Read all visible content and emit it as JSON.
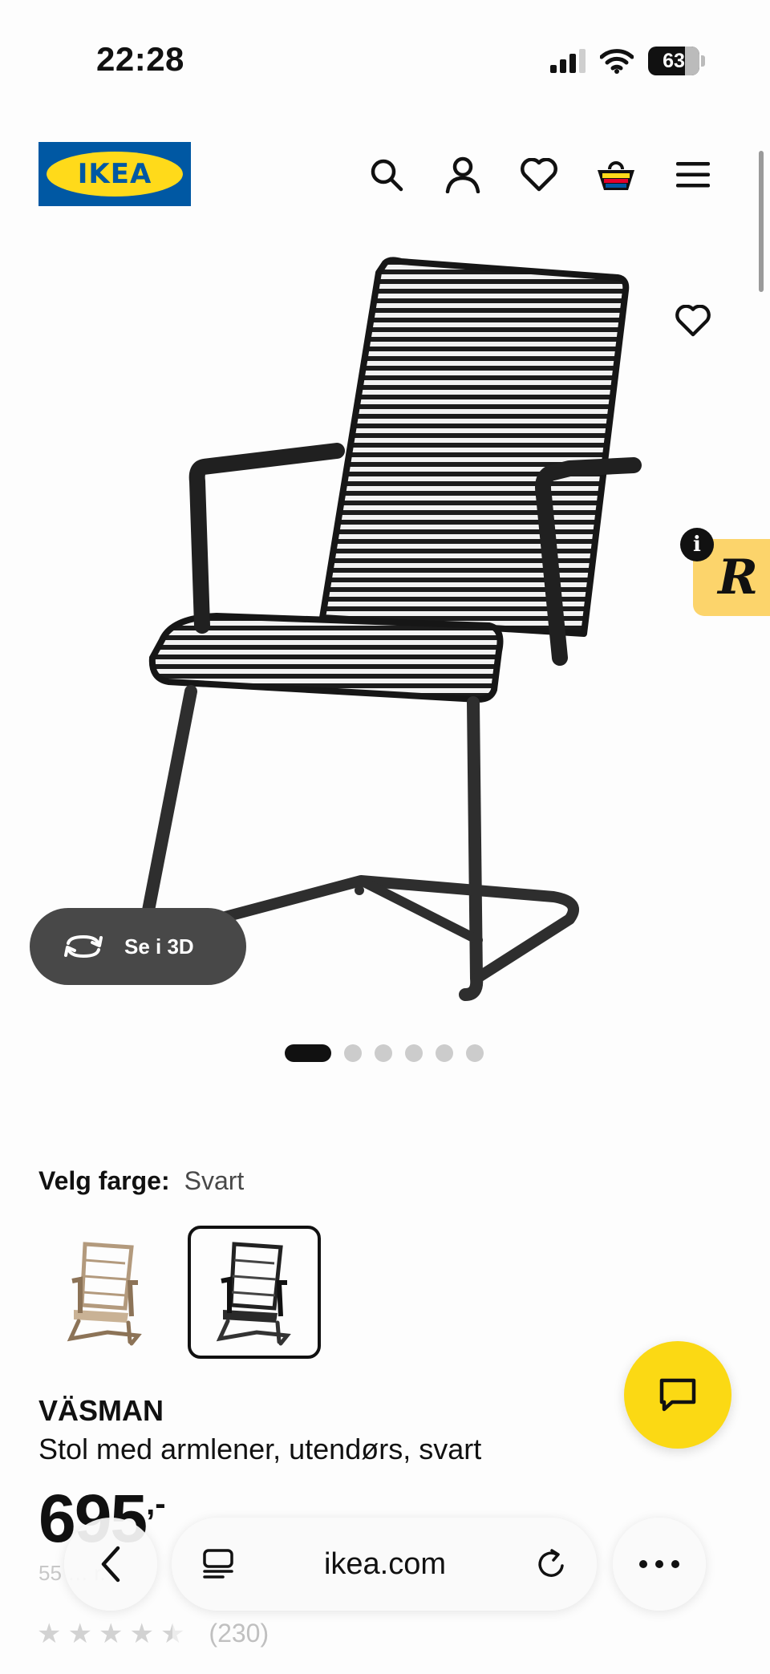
{
  "status_bar": {
    "time": "22:28",
    "battery": "63",
    "icons": [
      "signal-icon",
      "wifi-icon",
      "battery-icon"
    ]
  },
  "header": {
    "logo_text": "IKEA",
    "icons": [
      "search-icon",
      "account-icon",
      "favorites-icon",
      "cart-icon",
      "menu-icon"
    ]
  },
  "gallery": {
    "image_subject": "chair",
    "view_3d_label": "Se i 3D",
    "page_count": 6,
    "active_page": 1
  },
  "color_picker": {
    "label": "Velg farge:",
    "selected": "Svart",
    "swatch_count": 2,
    "selected_index": 2
  },
  "product": {
    "name": "VÄSMAN",
    "description": "Stol med armlener, utendørs, svart",
    "price": "695",
    "price_suffix": ",-",
    "unit_price": "55 … r.",
    "rating_stars": 4.5,
    "rating_count": "(230)"
  },
  "browser": {
    "url": "ikea.com"
  },
  "colors": {
    "ikea_blue": "#0058a3",
    "ikea_yellow": "#ffda1a",
    "chat_yellow": "#fbd914",
    "badge_yellow": "#fcd46b"
  }
}
